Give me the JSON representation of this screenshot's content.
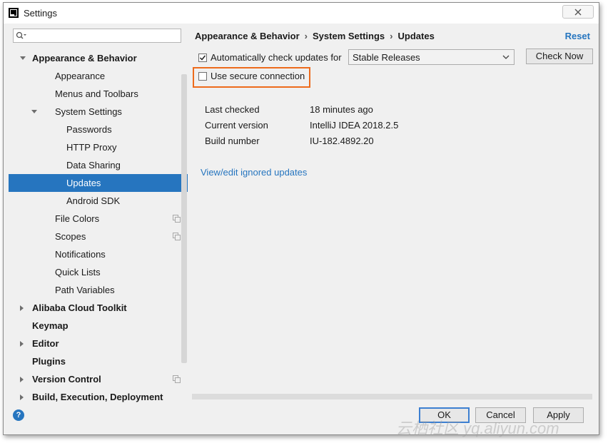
{
  "window": {
    "title": "Settings"
  },
  "search": {
    "placeholder": ""
  },
  "tree": [
    {
      "label": "Appearance & Behavior",
      "bold": true,
      "indent": 0,
      "arrow": "down",
      "selected": false,
      "copy": false
    },
    {
      "label": "Appearance",
      "bold": false,
      "indent": 1,
      "arrow": "",
      "selected": false,
      "copy": false
    },
    {
      "label": "Menus and Toolbars",
      "bold": false,
      "indent": 1,
      "arrow": "",
      "selected": false,
      "copy": false
    },
    {
      "label": "System Settings",
      "bold": false,
      "indent": 1,
      "arrow": "down",
      "selected": false,
      "copy": false
    },
    {
      "label": "Passwords",
      "bold": false,
      "indent": 2,
      "arrow": "",
      "selected": false,
      "copy": false
    },
    {
      "label": "HTTP Proxy",
      "bold": false,
      "indent": 2,
      "arrow": "",
      "selected": false,
      "copy": false
    },
    {
      "label": "Data Sharing",
      "bold": false,
      "indent": 2,
      "arrow": "",
      "selected": false,
      "copy": false
    },
    {
      "label": "Updates",
      "bold": false,
      "indent": 2,
      "arrow": "",
      "selected": true,
      "copy": false
    },
    {
      "label": "Android SDK",
      "bold": false,
      "indent": 2,
      "arrow": "",
      "selected": false,
      "copy": false
    },
    {
      "label": "File Colors",
      "bold": false,
      "indent": 1,
      "arrow": "",
      "selected": false,
      "copy": true
    },
    {
      "label": "Scopes",
      "bold": false,
      "indent": 1,
      "arrow": "",
      "selected": false,
      "copy": true
    },
    {
      "label": "Notifications",
      "bold": false,
      "indent": 1,
      "arrow": "",
      "selected": false,
      "copy": false
    },
    {
      "label": "Quick Lists",
      "bold": false,
      "indent": 1,
      "arrow": "",
      "selected": false,
      "copy": false
    },
    {
      "label": "Path Variables",
      "bold": false,
      "indent": 1,
      "arrow": "",
      "selected": false,
      "copy": false
    },
    {
      "label": "Alibaba Cloud Toolkit",
      "bold": true,
      "indent": 0,
      "arrow": "right",
      "selected": false,
      "copy": false
    },
    {
      "label": "Keymap",
      "bold": true,
      "indent": 0,
      "arrow": "",
      "selected": false,
      "copy": false
    },
    {
      "label": "Editor",
      "bold": true,
      "indent": 0,
      "arrow": "right",
      "selected": false,
      "copy": false
    },
    {
      "label": "Plugins",
      "bold": true,
      "indent": 0,
      "arrow": "",
      "selected": false,
      "copy": false
    },
    {
      "label": "Version Control",
      "bold": true,
      "indent": 0,
      "arrow": "right",
      "selected": false,
      "copy": true
    },
    {
      "label": "Build, Execution, Deployment",
      "bold": true,
      "indent": 0,
      "arrow": "right",
      "selected": false,
      "copy": false
    }
  ],
  "breadcrumb": {
    "part1": "Appearance & Behavior",
    "part2": "System Settings",
    "part3": "Updates",
    "sep": "›"
  },
  "reset_label": "Reset",
  "auto_check": {
    "label": "Automatically check updates for",
    "checked": true
  },
  "channel_select": {
    "value": "Stable Releases"
  },
  "check_now_label": "Check Now",
  "secure_connection": {
    "label": "Use secure connection",
    "checked": false
  },
  "info": [
    {
      "label": "Last checked",
      "value": "18 minutes ago"
    },
    {
      "label": "Current version",
      "value": "IntelliJ IDEA 2018.2.5"
    },
    {
      "label": "Build number",
      "value": "IU-182.4892.20"
    }
  ],
  "ignored_link": "View/edit ignored updates",
  "buttons": {
    "ok": "OK",
    "cancel": "Cancel",
    "apply": "Apply"
  },
  "help_label": "?",
  "watermark": "云栖社区 yq.aliyun.com",
  "colors": {
    "accent": "#2675bf",
    "highlight": "#ed6b1c",
    "background": "#f0f0f0"
  },
  "icons": {
    "close": "close-icon",
    "search": "search-icon",
    "help": "help-icon",
    "copy": "copy-icon",
    "dropdown": "chevron-down-icon"
  }
}
